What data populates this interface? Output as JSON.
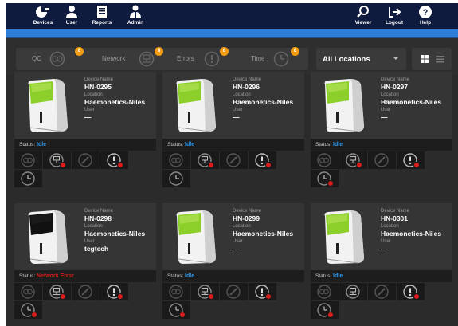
{
  "nav": {
    "left": [
      {
        "label": "Devices",
        "icon": "devices-icon"
      },
      {
        "label": "User",
        "icon": "user-icon"
      },
      {
        "label": "Reports",
        "icon": "reports-icon"
      },
      {
        "label": "Admin",
        "icon": "admin-icon"
      }
    ],
    "right": [
      {
        "label": "Viewer",
        "icon": "viewer-icon"
      },
      {
        "label": "Logout",
        "icon": "logout-icon"
      },
      {
        "label": "Help",
        "icon": "help-icon"
      }
    ]
  },
  "filters": [
    {
      "label": "QC",
      "count": "8",
      "icon": "qc-icon"
    },
    {
      "label": "Network",
      "count": "8",
      "icon": "network-icon"
    },
    {
      "label": "Errors",
      "count": "8",
      "icon": "errors-icon"
    },
    {
      "label": "Time",
      "count": "8",
      "icon": "time-icon"
    }
  ],
  "location_select": {
    "value": "All Locations"
  },
  "labels": {
    "device_name": "Device Name",
    "location": "Location",
    "user": "User",
    "status": "Status:"
  },
  "colors": {
    "idle": "#2e9bf0",
    "network_error": "#d81b1b",
    "badge": "#f39c12",
    "alert_dot": "#d81b1b",
    "nav_bar": "#0e1b3f",
    "accent": "#2c7ed9"
  },
  "devices": [
    {
      "name": "HN-0295",
      "location": "Haemonetics-Niles",
      "user": "—",
      "status": "Idle",
      "status_kind": "idle",
      "screen": "green",
      "alerts": {
        "network": true,
        "errors": true,
        "time": false
      }
    },
    {
      "name": "HN-0296",
      "location": "Haemonetics-Niles",
      "user": "—",
      "status": "Idle",
      "status_kind": "idle",
      "screen": "green",
      "alerts": {
        "network": true,
        "errors": true,
        "time": false
      }
    },
    {
      "name": "HN-0297",
      "location": "Haemonetics-Niles",
      "user": "—",
      "status": "Idle",
      "status_kind": "idle",
      "screen": "green",
      "alerts": {
        "network": true,
        "errors": true,
        "time": true
      }
    },
    {
      "name": "HN-0298",
      "location": "Haemonetics-Niles",
      "user": "tegtech",
      "status": "Network Error",
      "status_kind": "network_error",
      "screen": "dark",
      "alerts": {
        "network": true,
        "errors": true,
        "time": true
      }
    },
    {
      "name": "HN-0299",
      "location": "Haemonetics-Niles",
      "user": "—",
      "status": "Idle",
      "status_kind": "idle",
      "screen": "green",
      "alerts": {
        "network": true,
        "errors": true,
        "time": true
      }
    },
    {
      "name": "HN-0301",
      "location": "Haemonetics-Niles",
      "user": "—",
      "status": "Idle",
      "status_kind": "idle",
      "screen": "green",
      "alerts": {
        "network": false,
        "errors": true,
        "time": true
      }
    }
  ]
}
